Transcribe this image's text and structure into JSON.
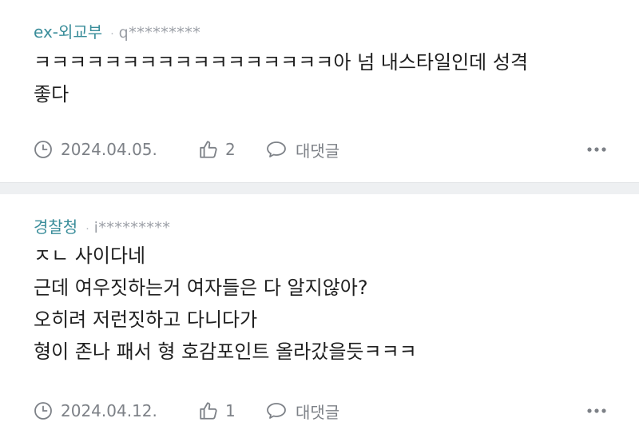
{
  "comments": [
    {
      "nickname": "ex-외교부",
      "separator": "·",
      "user_id": "q*********",
      "lines": [
        "ㅋㅋㅋㅋㅋㅋㅋㅋㅋㅋㅋㅋㅋㅋㅋㅋㅋ아 넘 내스타일인데 성격",
        "좋다"
      ],
      "date": "2024.04.05.",
      "likes": "2",
      "reply_label": "대댓글",
      "more_icon": "more-dots-icon"
    },
    {
      "nickname": "경찰청",
      "separator": "·",
      "user_id": "i*********",
      "lines": [
        "ㅈㄴ 사이다네",
        "근데 여우짓하는거 여자들은 다 알지않아?",
        "오히려 저런짓하고 다니다가",
        "형이 존나 패서 형 호감포인트 올라갔을듯ㅋㅋㅋ"
      ],
      "date": "2024.04.12.",
      "likes": "1",
      "reply_label": "대댓글",
      "more_icon": "more-dots-icon"
    }
  ],
  "colors": {
    "nickname": "#3a8d9a",
    "meta_gray": "#9a9ea5",
    "action_gray": "#7d8187",
    "divider": "#eef0f2"
  }
}
